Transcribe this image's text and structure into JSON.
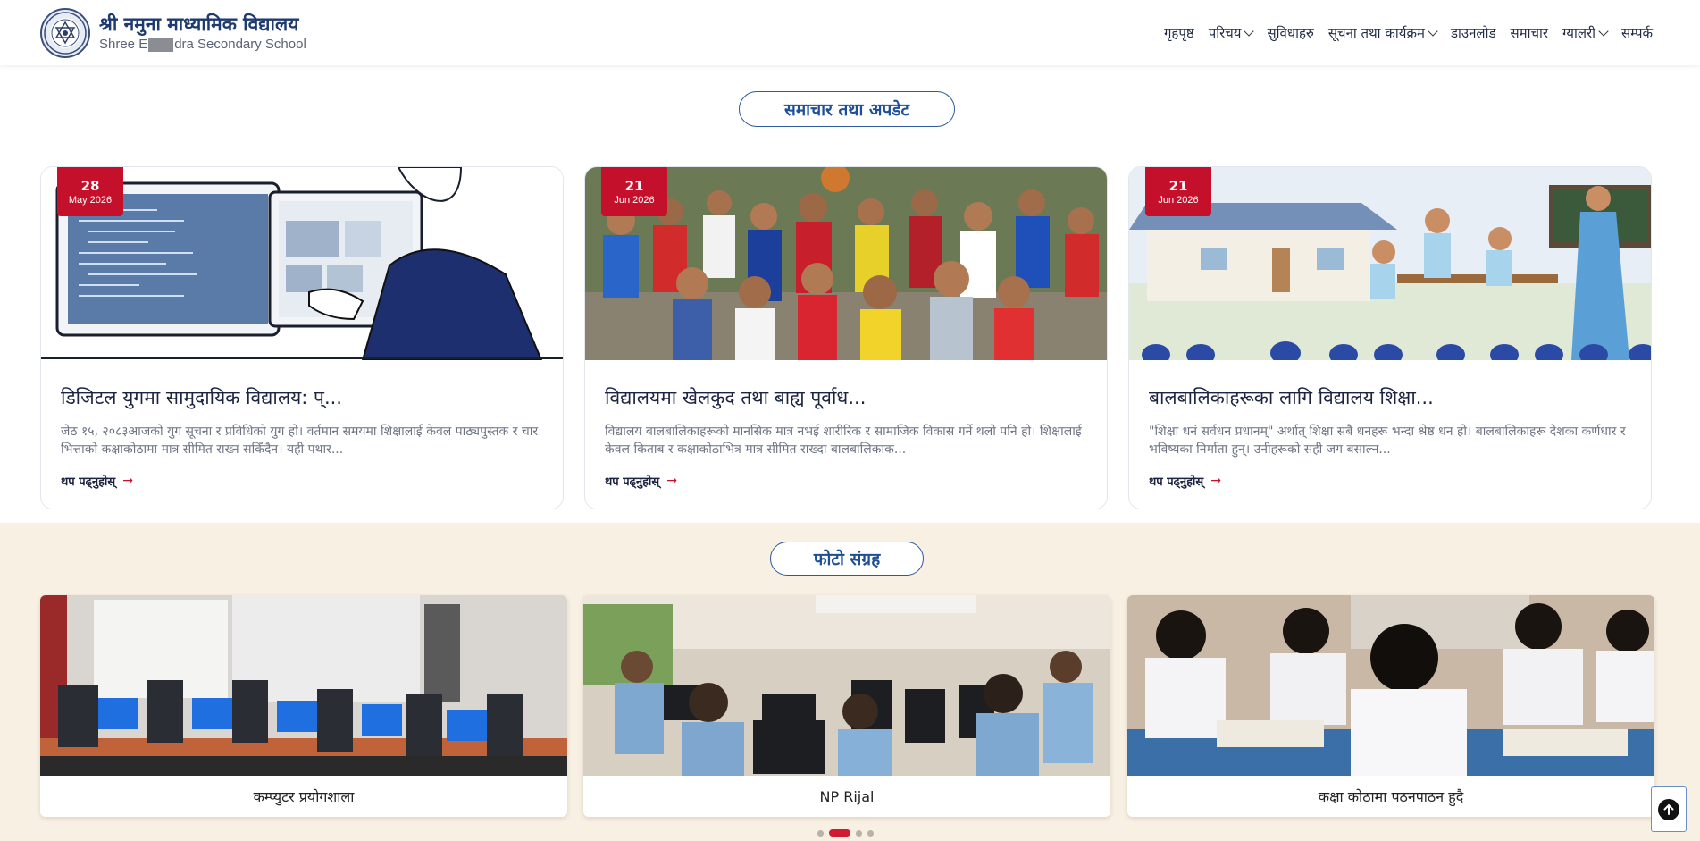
{
  "header": {
    "title": "श्री नमुना माध्यामिक विद्यालय",
    "subtitle_start": "Shree E",
    "subtitle_end": "dra Secondary School",
    "nav": [
      {
        "label": "गृहपृष्ठ",
        "dropdown": false
      },
      {
        "label": "परिचय",
        "dropdown": true
      },
      {
        "label": "सुविधाहरु",
        "dropdown": false
      },
      {
        "label": "सूचना तथा कार्यक्रम",
        "dropdown": true
      },
      {
        "label": "डाउनलोड",
        "dropdown": false
      },
      {
        "label": "समाचार",
        "dropdown": false
      },
      {
        "label": "ग्यालरी",
        "dropdown": true
      },
      {
        "label": "सम्पर्क",
        "dropdown": false
      }
    ]
  },
  "news": {
    "section_title": "समाचार तथा अपडेट",
    "cards": [
      {
        "day": "28",
        "month": "May 2026",
        "title": "डिजिटल युगमा सामुदायिक विद्यालय: प्...",
        "excerpt": "जेठ १५, २०८३आजको युग सूचना र प्रविधिको युग हो। वर्तमान समयमा शिक्षालाई केवल पाठ्यपुस्तक र चार भित्ताको कक्षाकोठामा मात्र सीमित राख्न सकिँदैन। यही पथार...",
        "read_more": "थप पढ्नुहोस्",
        "image": "illustration-computer"
      },
      {
        "day": "21",
        "month": "Jun 2026",
        "title": "विद्यालयमा खेलकुद तथा बाह्य पूर्वाध...",
        "excerpt": "विद्यालय बालबालिकाहरूको मानसिक मात्र नभई शारीरिक र सामाजिक विकास गर्ने थलो पनि हो। शिक्षालाई केवल किताब र कक्षाकोठाभित्र मात्र सीमित राख्दा बालबालिकाक...",
        "read_more": "थप पढ्नुहोस्",
        "image": "photo-children"
      },
      {
        "day": "21",
        "month": "Jun 2026",
        "title": "बालबालिकाहरूका लागि विद्यालय शिक्षा...",
        "excerpt": "\"शिक्षा धनं सर्वधन प्रधानम्\" अर्थात् शिक्षा सबै धनहरू भन्दा श्रेष्ठ धन हो। बालबालिकाहरू देशका कर्णधार र भविष्यका निर्माता हुन्। उनीहरूको सही जग बसाल्न...",
        "read_more": "थप पढ्नुहोस्",
        "image": "illustration-classroom"
      }
    ]
  },
  "gallery": {
    "section_title": "फोटो संग्रह",
    "photos": [
      {
        "caption": "कम्प्युटर प्रयोगशाला",
        "image": "photo-computer-lab"
      },
      {
        "caption": "NP Rijal",
        "image": "photo-students-computers"
      },
      {
        "caption": "कक्षा कोठामा पठनपाठन हुदै",
        "image": "photo-exam-hall"
      }
    ],
    "dots_total": 4,
    "dots_active": 1
  },
  "colors": {
    "accent_red": "#c5102b",
    "brand_blue": "#1e3a6e",
    "gallery_bg": "#f8f0e2"
  },
  "icons": {
    "scroll_top": "arrow-up-icon",
    "logo": "school-emblem-icon"
  }
}
